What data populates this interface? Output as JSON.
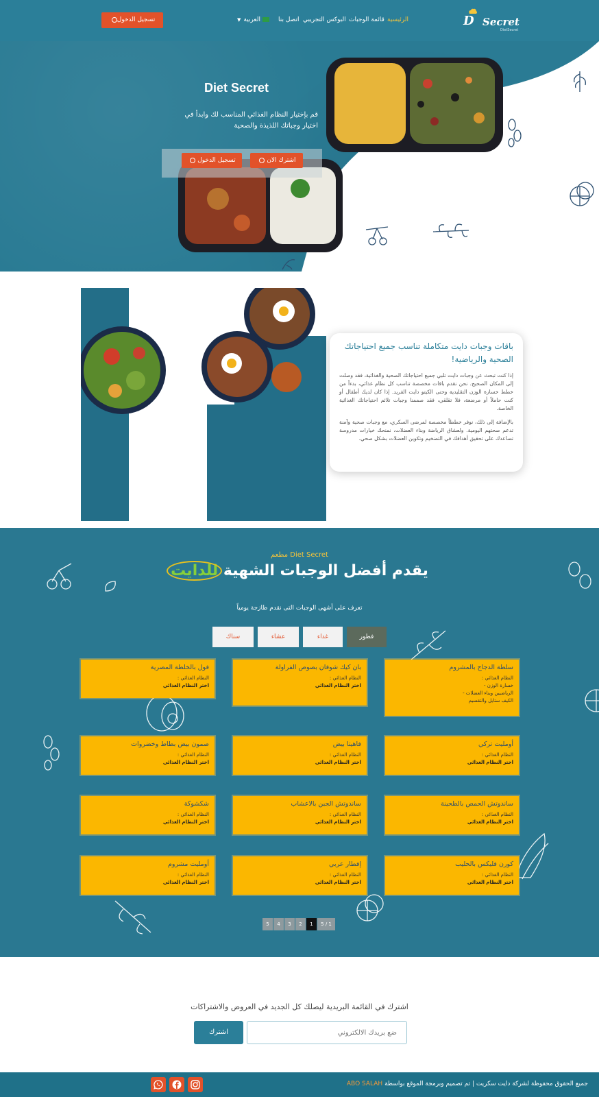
{
  "header": {
    "logo_text": "Secret",
    "logo_mark": "D",
    "logo_sub": "DietSecret",
    "nav": [
      {
        "label": "الرئيسية",
        "active": true
      },
      {
        "label": "قائمة الوجبات",
        "active": false
      },
      {
        "label": "البوكس التجريبي",
        "active": false
      },
      {
        "label": "اتصل بنا",
        "active": false
      },
      {
        "label": "العربية",
        "active": false
      }
    ],
    "login_button": "تسجيل الدخول"
  },
  "hero": {
    "title": "Diet Secret",
    "subtitle": "قم بإختيار النظام الغذائي المناسب لك وابدأ في اختيار وجباتك اللذيذة والصحية",
    "join_button": "اشترك الان",
    "login_button": "تسجيل الدخول"
  },
  "about": {
    "title": "باقات وجبات دايت متكاملة تناسب جميع احتياجاتك الصحية والرياضية!",
    "paragraph1": "إذا كنت تبحث عن وجبات دايت تلبي جميع احتياجاتك الصحية والغذائية، فقد وصلت إلى المكان الصحيح. نحن نقدم باقات مخصصة تناسب كل نظام غذائي، بدءاً من خطط خسارة الوزن التقليدية وحتى الكيتو دايت الفريد. إذا كان لديك أطفال أو كنت حاملاً أو مرضعة، فلا تقلقي، فقد صممنا وجبات تلائم احتياجاتك الغذائية الخاصة.",
    "paragraph2": "بالإضافة إلى ذلك، نوفر خططاً مخصصة لمرضى السكري، مع وجبات صحية وآمنة تدعم صحتهم اليومية. ولعشاق الرياضة وبناء العضلات، نمنحك خيارات مدروسة تساعدك على تحقيق أهدافك في التضخيم وتكوين العضلات بشكل صحي."
  },
  "menu": {
    "kicker": "مطعم Diet Secret",
    "title_before": "يقدم أفضل الوجبات الشهية ",
    "title_highlight": "للدايت",
    "subtitle": "تعرف على أشهى الوجبات التى نقدم طازجة يومياً",
    "tabs": [
      {
        "label": "فطور",
        "active": true
      },
      {
        "label": "غداء",
        "active": false
      },
      {
        "label": "عشاء",
        "active": false
      },
      {
        "label": "سناك",
        "active": false
      }
    ],
    "cards": [
      {
        "name": "سلطة الدجاج بالمشروم",
        "lines": [
          "النظام الغذائي :",
          "خسارة الوزن -",
          "الرياضيين وبناء العضلات -",
          "الكيف ستايل والتقسيم"
        ],
        "bold": ""
      },
      {
        "name": "بان كيك شوفان بصوص الفراولة",
        "lines": [
          "النظام الغذائي :"
        ],
        "bold": "اختر النظام الغذائي"
      },
      {
        "name": "فول بالخلطة المصرية",
        "lines": [
          "النظام الغذائي :"
        ],
        "bold": "اختر النظام الغذائي"
      },
      {
        "name": "أومليت تركي",
        "lines": [
          "النظام الغذائي :"
        ],
        "bold": "اختر النظام الغذائي"
      },
      {
        "name": "فاهيتا بيض",
        "lines": [
          "النظام الغذائي :"
        ],
        "bold": "اختر النظام الغذائي"
      },
      {
        "name": "صمون بيض بطاط وخضروات",
        "lines": [
          "النظام الغذائي :"
        ],
        "bold": "اختر النظام الغذائي"
      },
      {
        "name": "ساندوتش الحمص بالطحينة",
        "lines": [
          "النظام الغذائي :"
        ],
        "bold": "اختر النظام الغذائي"
      },
      {
        "name": "ساندوتش الجبن بالاعشاب",
        "lines": [
          "النظام الغذائي :"
        ],
        "bold": "اختر النظام الغذائي"
      },
      {
        "name": "شكشوكة",
        "lines": [
          "النظام الغذائي :"
        ],
        "bold": "اختر النظام الغذائي"
      },
      {
        "name": "كورن فليكس بالحليب",
        "lines": [
          "النظام الغذائي :"
        ],
        "bold": "اختر النظام الغذائي"
      },
      {
        "name": "إفطار عربي",
        "lines": [
          "النظام الغذائي :"
        ],
        "bold": "اختر النظام الغذائي"
      },
      {
        "name": "أومليت مشروم",
        "lines": [
          "النظام الغذائي :"
        ],
        "bold": "اختر النظام الغذائي"
      }
    ],
    "pager": [
      "5 / 1",
      "1",
      "2",
      "3",
      "4",
      "5"
    ]
  },
  "newsletter": {
    "text": "اشترك في القائمة البريدية ليصلك كل الجديد في العروض والاشتراكات",
    "placeholder": "ضع بريدك الالكتروني",
    "button": "اشترك"
  },
  "footer": {
    "text": "جميع الحقوق محفوظة لشركة دايت سكريت | تم تصميم وبرمجة الموقع بواسطة ",
    "brand": "ABO SALAH"
  },
  "icons": {
    "social": [
      "instagram-icon",
      "facebook-icon",
      "whatsapp-icon"
    ]
  },
  "colors": {
    "primary": "#2b7f99",
    "accent": "#e2522a",
    "card": "#fbb700",
    "highlight": "#86ce3b"
  }
}
